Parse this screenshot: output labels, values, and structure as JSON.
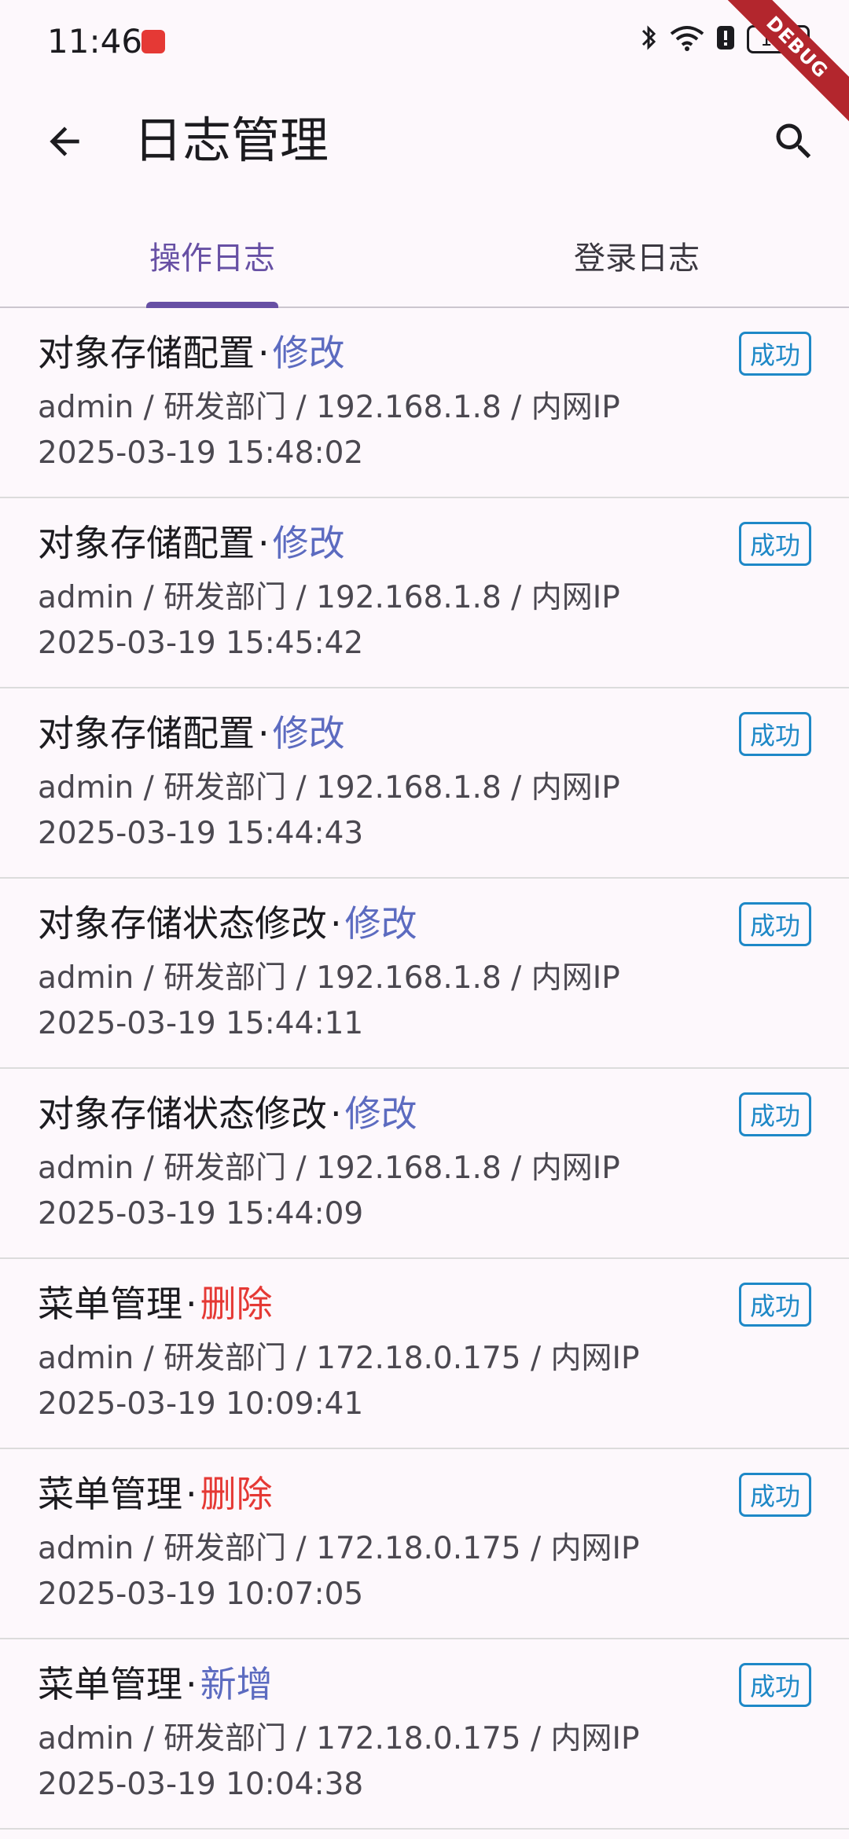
{
  "status_bar": {
    "time": "11:46",
    "battery": "100"
  },
  "debug_banner": "DEBUG",
  "appbar": {
    "title": "日志管理"
  },
  "tabs": [
    {
      "label": "操作日志",
      "active": true
    },
    {
      "label": "登录日志",
      "active": false
    }
  ],
  "logs": [
    {
      "module": "对象存储配置",
      "separator": "·",
      "operation": "修改",
      "op_type": "modify",
      "meta": "admin / 研发部门 / 192.168.1.8 / 内网IP",
      "time": "2025-03-19 15:48:02",
      "status": "成功"
    },
    {
      "module": "对象存储配置",
      "separator": "·",
      "operation": "修改",
      "op_type": "modify",
      "meta": "admin / 研发部门 / 192.168.1.8 / 内网IP",
      "time": "2025-03-19 15:45:42",
      "status": "成功"
    },
    {
      "module": "对象存储配置",
      "separator": "·",
      "operation": "修改",
      "op_type": "modify",
      "meta": "admin / 研发部门 / 192.168.1.8 / 内网IP",
      "time": "2025-03-19 15:44:43",
      "status": "成功"
    },
    {
      "module": "对象存储状态修改",
      "separator": "·",
      "operation": "修改",
      "op_type": "modify",
      "meta": "admin / 研发部门 / 192.168.1.8 / 内网IP",
      "time": "2025-03-19 15:44:11",
      "status": "成功"
    },
    {
      "module": "对象存储状态修改",
      "separator": "·",
      "operation": "修改",
      "op_type": "modify",
      "meta": "admin / 研发部门 / 192.168.1.8 / 内网IP",
      "time": "2025-03-19 15:44:09",
      "status": "成功"
    },
    {
      "module": "菜单管理",
      "separator": "·",
      "operation": "删除",
      "op_type": "delete",
      "meta": "admin / 研发部门 / 172.18.0.175 / 内网IP",
      "time": "2025-03-19 10:09:41",
      "status": "成功"
    },
    {
      "module": "菜单管理",
      "separator": "·",
      "operation": "删除",
      "op_type": "delete",
      "meta": "admin / 研发部门 / 172.18.0.175 / 内网IP",
      "time": "2025-03-19 10:07:05",
      "status": "成功"
    },
    {
      "module": "菜单管理",
      "separator": "·",
      "operation": "新增",
      "op_type": "add",
      "meta": "admin / 研发部门 / 172.18.0.175 / 内网IP",
      "time": "2025-03-19 10:04:38",
      "status": "成功"
    }
  ],
  "colors": {
    "primary": "#6750a4",
    "op_modify": "#5c6bc0",
    "op_delete": "#e53935",
    "status_success": "#1e88c7"
  }
}
